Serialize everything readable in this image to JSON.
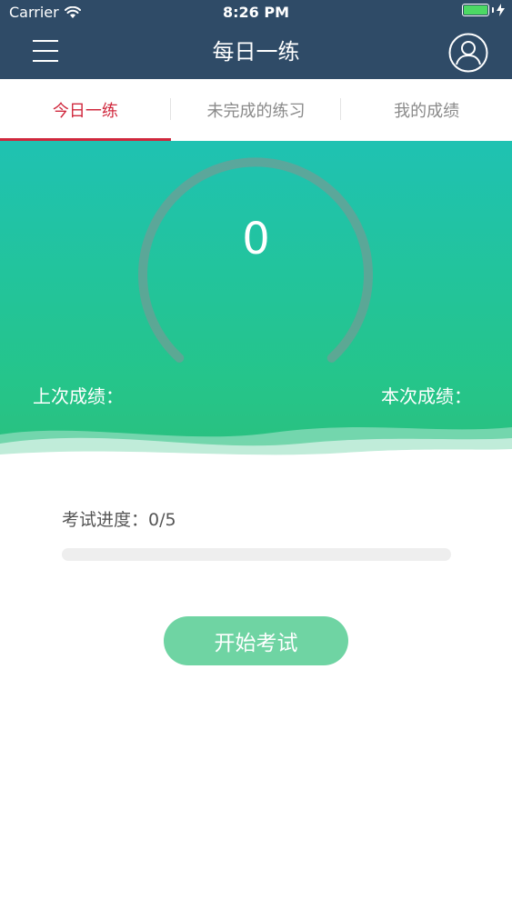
{
  "status_bar": {
    "carrier": "Carrier",
    "time": "8:26 PM",
    "battery_level": 1.0
  },
  "nav": {
    "title": "每日一练",
    "menu_icon": "hamburger-menu-icon",
    "user_icon": "user-avatar-icon"
  },
  "tabs": [
    {
      "label": "今日一练",
      "active": true
    },
    {
      "label": "未完成的练习",
      "active": false
    },
    {
      "label": "我的成绩",
      "active": false
    }
  ],
  "score": {
    "value": "0",
    "last_label": "上次成绩：",
    "current_label": "本次成绩："
  },
  "progress": {
    "label": "考试进度：0/5",
    "completed": 0,
    "total": 5
  },
  "start_button": {
    "label": "开始考试"
  },
  "colors": {
    "nav_bg": "#2f4b67",
    "tab_active": "#d0283d",
    "hero_top": "#1fc2b2",
    "hero_bottom": "#25c58a",
    "button": "#6fd4a3",
    "battery": "#4cd964"
  }
}
